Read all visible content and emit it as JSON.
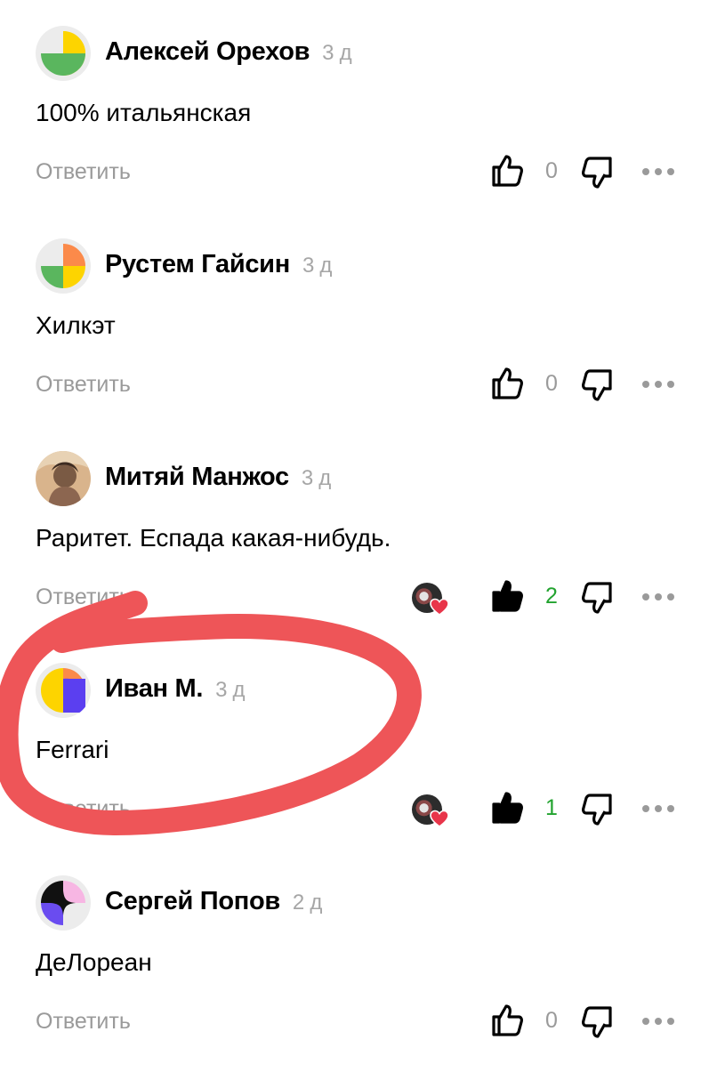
{
  "comments": [
    {
      "author": "Алексей Орехов",
      "time": "3 д",
      "text": "100% итальянская",
      "reply_label": "Ответить",
      "likes": "0",
      "liked": false,
      "reaction": false,
      "avatar": "yellow-green-leaf-avatar"
    },
    {
      "author": "Рустем Гайсин",
      "time": "3 д",
      "text": "Хилкэт",
      "reply_label": "Ответить",
      "likes": "0",
      "liked": false,
      "reaction": false,
      "avatar": "orange-green-yellow-avatar"
    },
    {
      "author": "Митяй Манжос",
      "time": "3 д",
      "text": "Раритет. Еспада какая-нибудь.",
      "reply_label": "Ответить",
      "likes": "2",
      "liked": true,
      "reaction": true,
      "avatar": "user-photo-avatar"
    },
    {
      "author": "Иван М.",
      "time": "3 д",
      "text": "Ferrari",
      "reply_label": "Ответить",
      "likes": "1",
      "liked": true,
      "reaction": true,
      "avatar": "yellow-purple-avatar"
    },
    {
      "author": "Сергей Попов",
      "time": "2 д",
      "text": "ДеЛореан",
      "reply_label": "Ответить",
      "likes": "0",
      "liked": false,
      "reaction": false,
      "avatar": "black-pink-star-avatar"
    }
  ],
  "colors": {
    "like_count_positive": "#22a32f",
    "muted": "#9a9a9a",
    "highlight_marker": "#ee5558",
    "reaction_heart": "#e8354a"
  },
  "icons": [
    "thumb-up-icon",
    "thumb-down-icon",
    "more-dots-icon",
    "heart-icon"
  ]
}
